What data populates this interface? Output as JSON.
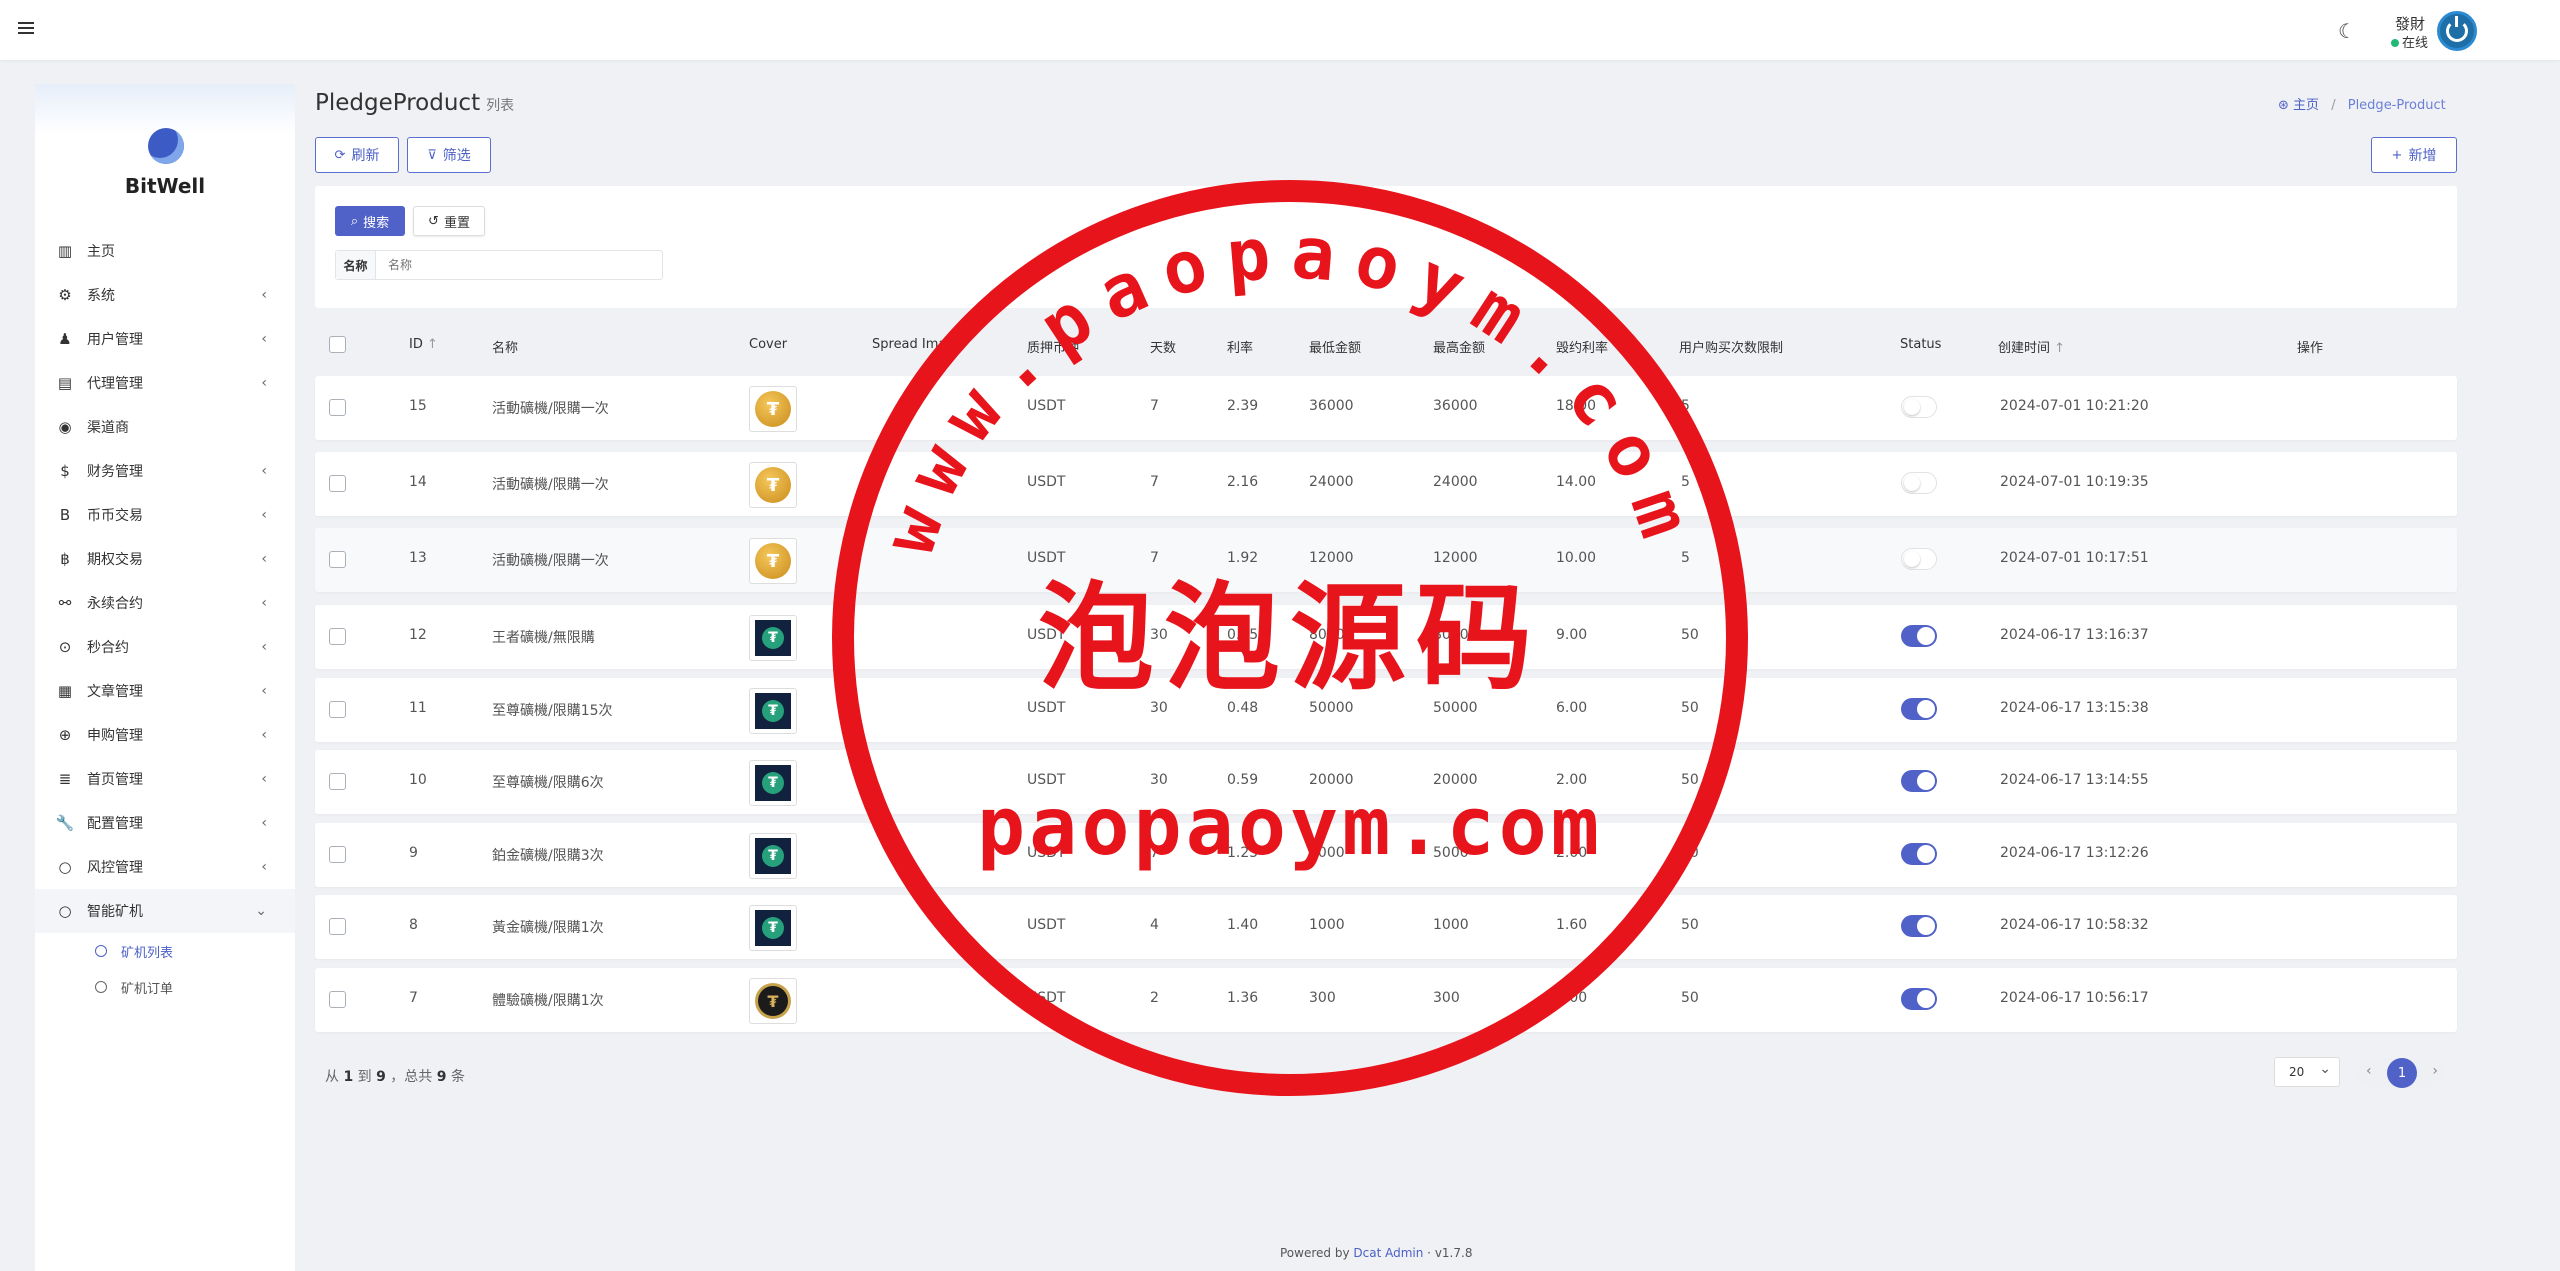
{
  "navbar": {
    "user_name": "發財",
    "user_status": "在线"
  },
  "sidebar": {
    "brand": "BitWell",
    "items": [
      {
        "label": "主页",
        "icon": "bar-chart-icon",
        "glyph": "▥",
        "has_children": false
      },
      {
        "label": "系统",
        "icon": "gear-icon",
        "glyph": "⚙",
        "has_children": true
      },
      {
        "label": "用户管理",
        "icon": "user-tie-icon",
        "glyph": "♟",
        "has_children": true
      },
      {
        "label": "代理管理",
        "icon": "id-card-icon",
        "glyph": "▤",
        "has_children": true
      },
      {
        "label": "渠道商",
        "icon": "user-circle-icon",
        "glyph": "◉",
        "has_children": false
      },
      {
        "label": "财务管理",
        "icon": "dollar-icon",
        "glyph": "$",
        "has_children": true
      },
      {
        "label": "币币交易",
        "icon": "bitcoin-icon",
        "glyph": "B",
        "has_children": true
      },
      {
        "label": "期权交易",
        "icon": "bitcoin-circle-icon",
        "glyph": "฿",
        "has_children": true
      },
      {
        "label": "永续合约",
        "icon": "link-icon",
        "glyph": "⚯",
        "has_children": true
      },
      {
        "label": "秒合约",
        "icon": "dot-circle-icon",
        "glyph": "⊙",
        "has_children": true
      },
      {
        "label": "文章管理",
        "icon": "newspaper-icon",
        "glyph": "▦",
        "has_children": true
      },
      {
        "label": "申购管理",
        "icon": "lifebuoy-icon",
        "glyph": "⊕",
        "has_children": true
      },
      {
        "label": "首页管理",
        "icon": "list-icon",
        "glyph": "≣",
        "has_children": true
      },
      {
        "label": "配置管理",
        "icon": "wrench-icon",
        "glyph": "🔧",
        "has_children": true
      },
      {
        "label": "风控管理",
        "icon": "circle-icon",
        "glyph": "○",
        "has_children": true
      },
      {
        "label": "智能矿机",
        "icon": "circle-icon",
        "glyph": "○",
        "has_children": true,
        "open": true
      }
    ],
    "sub_items": [
      {
        "label": "矿机列表",
        "active": true
      },
      {
        "label": "矿机订单",
        "active": false
      }
    ]
  },
  "header": {
    "title": "PledgeProduct",
    "subtitle": "列表",
    "breadcrumb_home": "主页",
    "breadcrumb_current": "Pledge-Product"
  },
  "toolbar": {
    "refresh_label": "刷新",
    "filter_label": "筛选",
    "new_label": "新增"
  },
  "filter": {
    "search_label": "搜索",
    "reset_label": "重置",
    "name_label": "名称",
    "name_placeholder": "名称",
    "name_value": ""
  },
  "table": {
    "columns": [
      "ID",
      "名称",
      "Cover",
      "Spread Ima",
      "质押币种",
      "天数",
      "利率",
      "最低金额",
      "最高金额",
      "毁约利率",
      "用户购买次数限制",
      "Status",
      "创建时间",
      "操作"
    ],
    "rows": [
      {
        "id": "15",
        "name": "活動礦機/限購一次",
        "cover": "gold",
        "currency": "USDT",
        "days": "7",
        "rate": "2.39",
        "min": "36000",
        "max": "36000",
        "penalty": "18.00",
        "limit": "5",
        "status": false,
        "created": "2024-07-01 10:21:20"
      },
      {
        "id": "14",
        "name": "活動礦機/限購一次",
        "cover": "gold",
        "currency": "USDT",
        "days": "7",
        "rate": "2.16",
        "min": "24000",
        "max": "24000",
        "penalty": "14.00",
        "limit": "5",
        "status": false,
        "created": "2024-07-01 10:19:35"
      },
      {
        "id": "13",
        "name": "活動礦機/限購一次",
        "cover": "gold",
        "currency": "USDT",
        "days": "7",
        "rate": "1.92",
        "min": "12000",
        "max": "12000",
        "penalty": "10.00",
        "limit": "5",
        "status": false,
        "created": "2024-07-01 10:17:51"
      },
      {
        "id": "12",
        "name": "王者礦機/無限購",
        "cover": "dark",
        "currency": "USDT",
        "days": "30",
        "rate": "0.45",
        "min": "80000",
        "max": "80000",
        "penalty": "9.00",
        "limit": "50",
        "status": true,
        "created": "2024-06-17 13:16:37"
      },
      {
        "id": "11",
        "name": "至尊礦機/限購15次",
        "cover": "dark",
        "currency": "USDT",
        "days": "30",
        "rate": "0.48",
        "min": "50000",
        "max": "50000",
        "penalty": "6.00",
        "limit": "50",
        "status": true,
        "created": "2024-06-17 13:15:38"
      },
      {
        "id": "10",
        "name": "至尊礦機/限購6次",
        "cover": "dark",
        "currency": "USDT",
        "days": "30",
        "rate": "0.59",
        "min": "20000",
        "max": "20000",
        "penalty": "2.00",
        "limit": "50",
        "status": true,
        "created": "2024-06-17 13:14:55"
      },
      {
        "id": "9",
        "name": "鉑金礦機/限購3次",
        "cover": "dark",
        "currency": "USDT",
        "days": "7",
        "rate": "1.25",
        "min": "5000",
        "max": "5000",
        "penalty": "2.00",
        "limit": "50",
        "status": true,
        "created": "2024-06-17 13:12:26"
      },
      {
        "id": "8",
        "name": "黃金礦機/限購1次",
        "cover": "dark",
        "currency": "USDT",
        "days": "4",
        "rate": "1.40",
        "min": "1000",
        "max": "1000",
        "penalty": "1.60",
        "limit": "50",
        "status": true,
        "created": "2024-06-17 10:58:32"
      },
      {
        "id": "7",
        "name": "體驗礦機/限購1次",
        "cover": "black",
        "currency": "USDT",
        "days": "2",
        "rate": "1.36",
        "min": "300",
        "max": "300",
        "penalty": "2.00",
        "limit": "50",
        "status": true,
        "created": "2024-06-17 10:56:17"
      }
    ]
  },
  "pagination": {
    "from": "1",
    "to": "9",
    "total": "9",
    "page_size": "20",
    "current_page": "1"
  },
  "footer": {
    "powered_by": "Powered by",
    "link": "Dcat Admin",
    "version": "v1.7.8"
  },
  "watermark": {
    "arc_text": "www.paopaoym.com",
    "center_text": "泡泡源码",
    "bottom_text": "paopaoym.com",
    "color": "#e8141c"
  },
  "colors": {
    "accent": "#5061c8",
    "background": "#eff1f5"
  }
}
